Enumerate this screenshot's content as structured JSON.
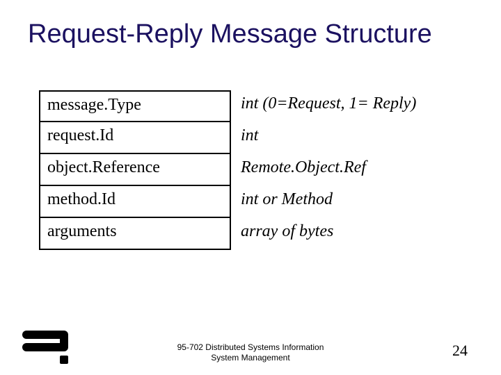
{
  "title": "Request-Reply Message Structure",
  "rows": [
    {
      "name": "message.Type",
      "type": "int   (0=Request, 1= Reply)"
    },
    {
      "name": "request.Id",
      "type": "int"
    },
    {
      "name": "object.Reference",
      "type": "Remote.Object.Ref"
    },
    {
      "name": "method.Id",
      "type": "int or Method"
    },
    {
      "name": "arguments",
      "type": "array of bytes"
    }
  ],
  "footer": {
    "line1": "95-702 Distributed Systems Information",
    "line2": "System Management"
  },
  "page_number": "24"
}
